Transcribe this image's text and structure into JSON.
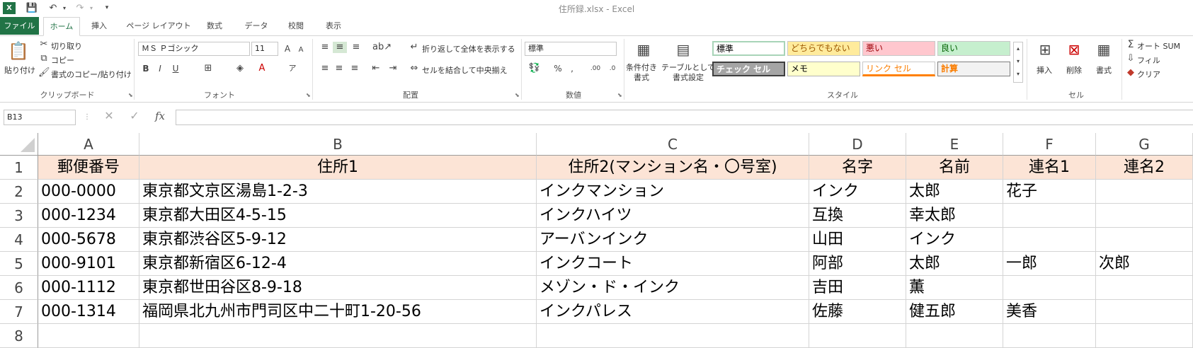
{
  "window": {
    "title": "住所録.xlsx - Excel"
  },
  "tabs": [
    "ファイル",
    "ホーム",
    "挿入",
    "ページ レイアウト",
    "数式",
    "データ",
    "校閲",
    "表示"
  ],
  "ribbon": {
    "clipboard": {
      "paste": "貼り付け",
      "cut": "切り取り",
      "copy": "コピー",
      "format_painter": "書式のコピー/貼り付け",
      "label": "クリップボード"
    },
    "font": {
      "name": "ＭＳ Ｐゴシック",
      "size": "11",
      "label": "フォント"
    },
    "alignment": {
      "wrap": "折り返して全体を表示する",
      "merge": "セルを結合して中央揃え",
      "label": "配置"
    },
    "number": {
      "format": "標準",
      "label": "数値"
    },
    "styles": {
      "conditional": "条件付き\n書式",
      "table": "テーブルとして\n書式設定",
      "cells": [
        "標準",
        "どちらでもない",
        "悪い",
        "良い",
        "チェック セル",
        "メモ",
        "リンク セル",
        "計算"
      ],
      "label": "スタイル"
    },
    "cells_group": {
      "insert": "挿入",
      "delete": "削除",
      "format": "書式",
      "label": "セル"
    },
    "editing": {
      "autosum": "オート SUM",
      "fill": "フィル",
      "clear": "クリア"
    }
  },
  "formula_bar": {
    "name_box": "B13",
    "fx": "fx",
    "content": ""
  },
  "sheet": {
    "columns": [
      "A",
      "B",
      "C",
      "D",
      "E",
      "F",
      "G"
    ],
    "row_numbers": [
      "1",
      "2",
      "3",
      "4",
      "5",
      "6",
      "7",
      "8"
    ],
    "header": [
      "郵便番号",
      "住所1",
      "住所2(マンション名・〇号室)",
      "名字",
      "名前",
      "連名1",
      "連名2"
    ],
    "rows": [
      [
        "000-0000",
        "東京都文京区湯島1-2-3",
        "インクマンション",
        "インク",
        "太郎",
        "花子",
        ""
      ],
      [
        "000-1234",
        "東京都大田区4-5-15",
        "インクハイツ",
        "互換",
        "幸太郎",
        "",
        ""
      ],
      [
        "000-5678",
        "東京都渋谷区5-9-12",
        "アーバンインク",
        "山田",
        "インク",
        "",
        ""
      ],
      [
        "000-9101",
        "東京都新宿区6-12-4",
        "インクコート",
        "阿部",
        "太郎",
        "一郎",
        "次郎"
      ],
      [
        "000-1112",
        "東京都世田谷区8-9-18",
        "メゾン・ド・インク",
        "吉田",
        "薫",
        "",
        ""
      ],
      [
        "000-1314",
        "福岡県北九州市門司区中二十町1-20-56",
        "インクパレス",
        "佐藤",
        "健五郎",
        "美香",
        ""
      ]
    ]
  },
  "colors": {
    "accent": "#217346",
    "header_fill": "#fce4d6"
  }
}
